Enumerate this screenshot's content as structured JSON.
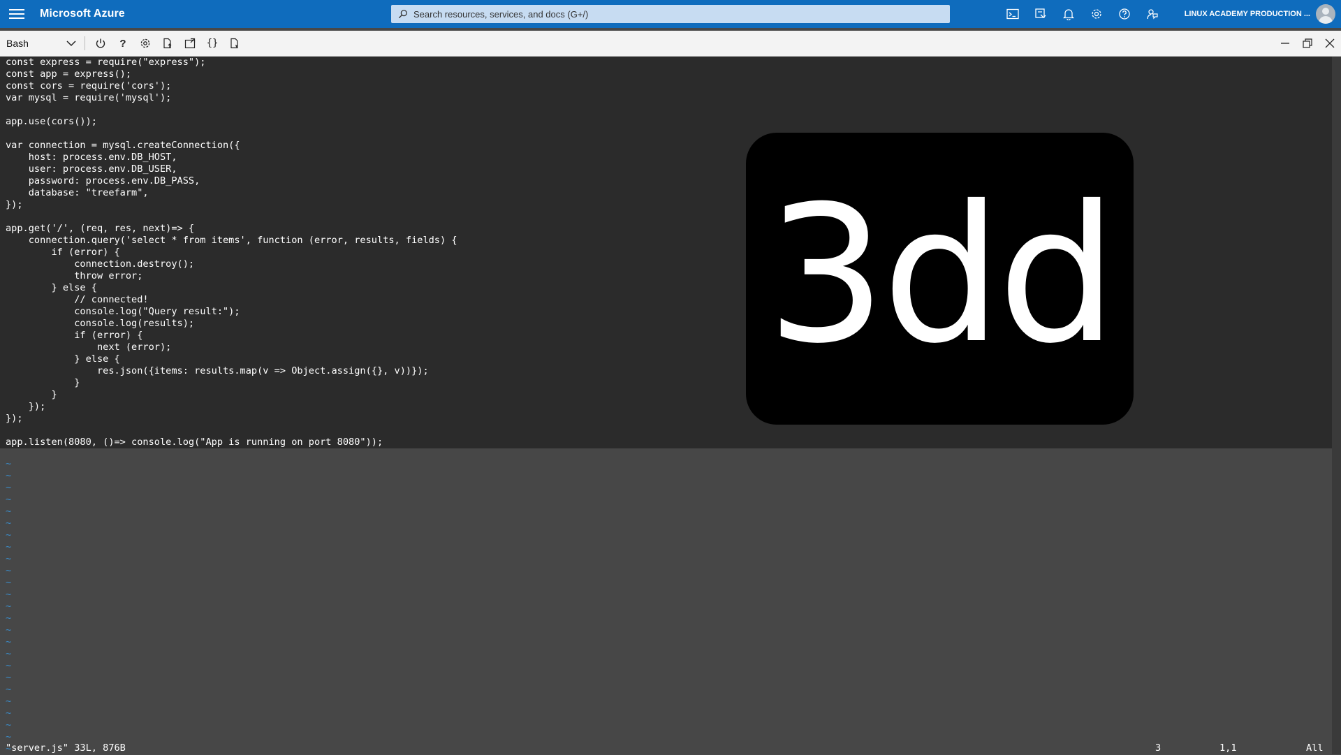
{
  "portal": {
    "brand": "Microsoft Azure",
    "search_placeholder": "Search resources, services, and docs (G+/)",
    "account": "LINUX ACADEMY PRODUCTION ...",
    "icons": [
      "cloud-shell-icon",
      "directory-filter-icon",
      "bell-icon",
      "gear-icon",
      "help-icon",
      "feedback-icon"
    ]
  },
  "shell": {
    "selected": "Bash",
    "toolbar_icons": [
      "power-icon",
      "help-icon",
      "settings-icon",
      "upload-icon",
      "open-session-icon",
      "braces-icon",
      "web-preview-icon"
    ]
  },
  "editor": {
    "code": "const express = require(\"express\");\nconst app = express();\nconst cors = require('cors');\nvar mysql = require('mysql');\n\napp.use(cors());\n\nvar connection = mysql.createConnection({\n    host: process.env.DB_HOST,\n    user: process.env.DB_USER,\n    password: process.env.DB_PASS,\n    database: \"treefarm\",\n});\n\napp.get('/', (req, res, next)=> {\n    connection.query('select * from items', function (error, results, fields) {\n        if (error) {\n            connection.destroy();\n            throw error;\n        } else {\n            // connected!\n            console.log(\"Query result:\");\n            console.log(results);\n            if (error) {\n                next (error);\n            } else {\n                res.json({items: results.map(v => Object.assign({}, v))});\n            }\n        }\n    });\n});\n\napp.listen(8080, ()=> console.log(\"App is running on port 8080\"));",
    "tilde_lines": "~\n~\n~\n~\n~\n~\n~\n~\n~\n~\n~\n~\n~\n~\n~\n~\n~\n~\n~\n~\n~\n~\n~\n~\n~",
    "status_file": "\"server.js\" 33L, 876B",
    "status_num": "3",
    "status_pos": "1,1",
    "status_all": "All"
  },
  "overlay": {
    "text": "3dd"
  },
  "colors": {
    "topbar": "#0f6cbd",
    "terminal": "#2b2b2b",
    "tilde": "#3b8cc9"
  }
}
